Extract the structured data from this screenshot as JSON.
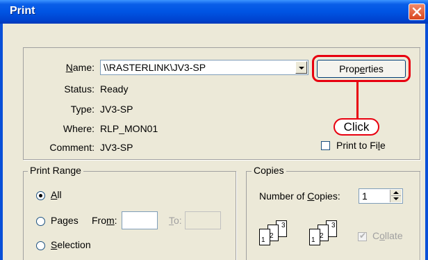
{
  "window": {
    "title": "Print"
  },
  "printer": {
    "name_label_underlined": "N",
    "name_label_rest": "ame:",
    "name_value": "\\\\RASTERLINK\\JV3-SP",
    "status_label": "Status:",
    "status_value": "Ready",
    "type_label": "Type:",
    "type_value": "JV3-SP",
    "where_label": "Where:",
    "where_value": "RLP_MON01",
    "comment_label": "Comment:",
    "comment_value": "JV3-SP",
    "properties_label_pre": "Prop",
    "properties_label_under": "e",
    "properties_label_post": "rties",
    "print_to_file_pre": "Print to Fi",
    "print_to_file_under": "l",
    "print_to_file_post": "e",
    "print_to_file_checked": false
  },
  "annotation": {
    "click_label": "Click",
    "color": "#e8000f"
  },
  "print_range": {
    "title": "Print Range",
    "all_under": "A",
    "all_rest": "ll",
    "pages_label": "Pages",
    "from_pre": "Fro",
    "from_under": "m",
    "from_post": ":",
    "to_under": "T",
    "to_post": "o:",
    "from_value": "",
    "to_value": "",
    "selection_under": "S",
    "selection_rest": "election",
    "selected": "All"
  },
  "copies": {
    "title": "Copies",
    "number_pre": "Number of ",
    "number_under": "C",
    "number_post": "opies:",
    "number_value": "1",
    "collate_pre": "C",
    "collate_under": "o",
    "collate_post": "llate",
    "collate_checked": true,
    "collate_enabled": false,
    "page_numbers": [
      "1",
      "2",
      "3"
    ]
  }
}
